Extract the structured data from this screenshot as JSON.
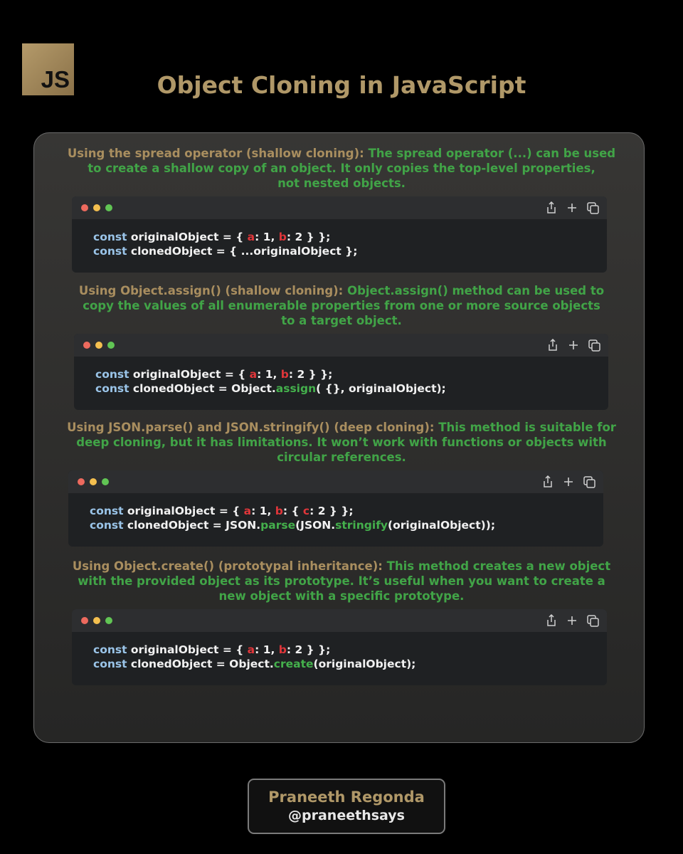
{
  "logo": {
    "text": "JS"
  },
  "title": "Object Cloning in JavaScript",
  "sections": [
    {
      "heading": "Using the spread operator (shallow cloning):",
      "desc_line1": " The spread operator (...) can be used",
      "desc_line2": "to create a shallow copy of an object. It only copies the top-level properties,",
      "desc_line3": "not nested objects.",
      "code": {
        "l1_kw": "const",
        "l1_a": " originalObject = { ",
        "l1_k1": "a",
        "l1_b": ": 1, ",
        "l1_k2": "b",
        "l1_c": ": 2 } };",
        "l2_kw": "const",
        "l2_a": " clonedObject = { ...originalObject };"
      }
    },
    {
      "heading": "Using Object.assign() (shallow cloning):",
      "desc_line1": " Object.assign() method can be used to",
      "desc_line2": "copy the values of all enumerable properties from one or more source objects",
      "desc_line3": "to a target object.",
      "code": {
        "l1_kw": "const",
        "l1_a": " originalObject = { ",
        "l1_k1": "a",
        "l1_b": ": 1, ",
        "l1_k2": "b",
        "l1_c": ": 2 } };",
        "l2_kw": "const",
        "l2_a": " clonedObject = Object.",
        "l2_fn": "assign",
        "l2_b": "( {}, originalObject);"
      }
    },
    {
      "heading": "Using JSON.parse() and JSON.stringify() (deep cloning):",
      "desc_line1": " This method is suitable for",
      "desc_line2": "deep cloning, but it has limitations. It won’t work with functions or objects with",
      "desc_line3": "circular references.",
      "code": {
        "l1_kw": "const",
        "l1_a": " originalObject = { ",
        "l1_k1": "a",
        "l1_b": ": 1, ",
        "l1_k2": "b",
        "l1_c": ": { ",
        "l1_k3": "c",
        "l1_d": ": 2 } };",
        "l2_kw": "const",
        "l2_a": " clonedObject = JSON.",
        "l2_fn": "parse",
        "l2_b": "(JSON.",
        "l2_fn2": "stringify",
        "l2_c": "(originalObject));"
      }
    },
    {
      "heading": "Using Object.create() (prototypal inheritance):",
      "desc_line1": " This method creates a new object",
      "desc_line2": "with the provided object as its prototype. It’s useful when you want to create a",
      "desc_line3": "new object with a specific prototype.",
      "code": {
        "l1_kw": "const",
        "l1_a": " originalObject = { ",
        "l1_k1": "a",
        "l1_b": ": 1, ",
        "l1_k2": "b",
        "l1_c": ": 2 } };",
        "l2_kw": "const",
        "l2_a": " clonedObject = Object.",
        "l2_fn": "create",
        "l2_b": "(originalObject);"
      }
    }
  ],
  "icons": {
    "share": "share-icon",
    "add": "plus-icon",
    "copy": "copy-icon"
  },
  "colors": {
    "gold": "#b09868",
    "green": "#41a447",
    "keyword": "#9ac4e8",
    "key_red": "#e0363a"
  },
  "author": {
    "name": "Praneeth Regonda",
    "handle": "@praneethsays"
  }
}
